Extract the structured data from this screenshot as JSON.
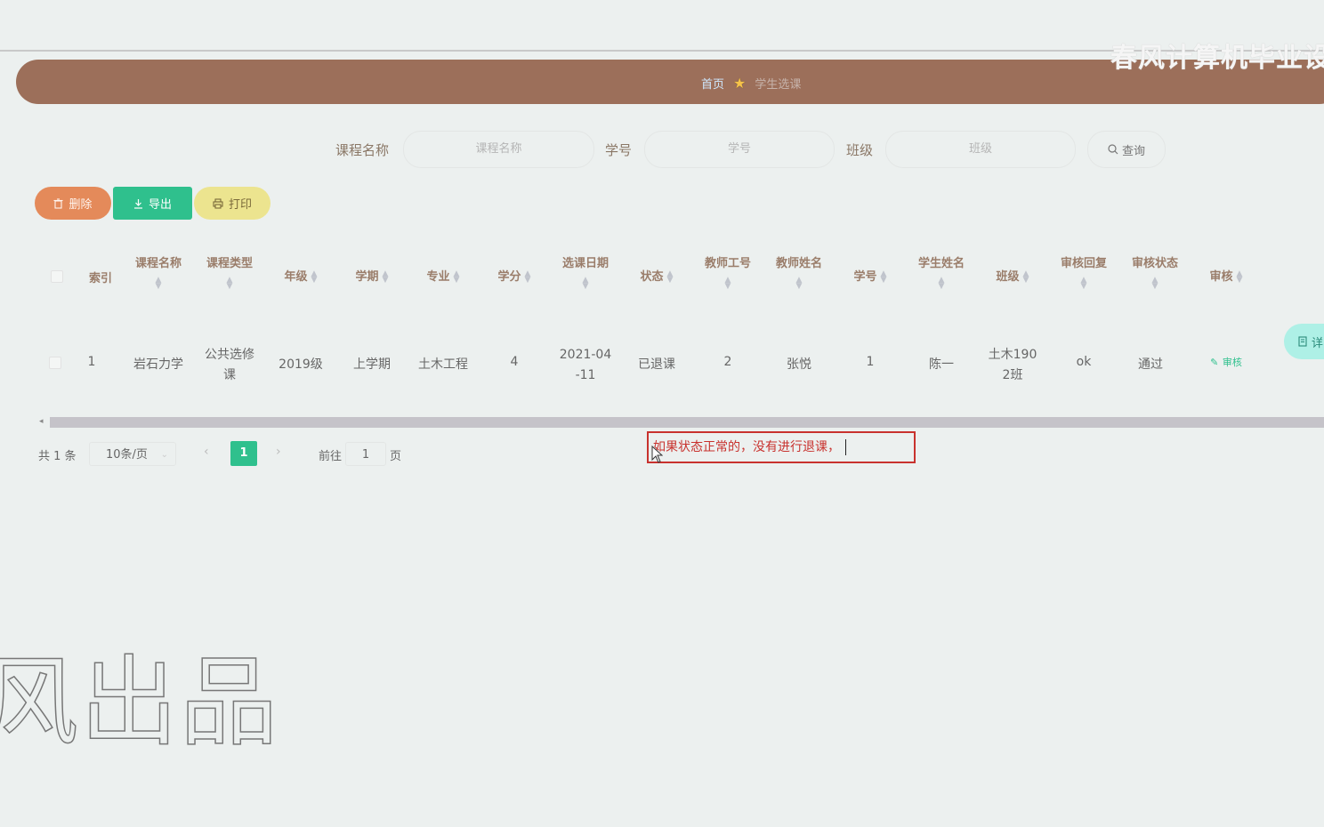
{
  "watermark": {
    "top": "春风计算机毕业设",
    "bottom": "风出品"
  },
  "breadcrumb": {
    "home": "首页",
    "current": "学生选课"
  },
  "search": {
    "course_label": "课程名称",
    "course_placeholder": "课程名称",
    "stuno_label": "学号",
    "stuno_placeholder": "学号",
    "class_label": "班级",
    "class_placeholder": "班级",
    "query_label": "查询"
  },
  "actions": {
    "delete_label": "删除",
    "export_label": "导出",
    "print_label": "打印"
  },
  "table": {
    "headers": {
      "index": "索引",
      "course": "课程名称",
      "ctype": "课程类型",
      "grade": "年级",
      "term": "学期",
      "major": "专业",
      "credit": "学分",
      "date": "选课日期",
      "status": "状态",
      "tno": "教师工号",
      "tname": "教师姓名",
      "sno": "学号",
      "sname": "学生姓名",
      "class": "班级",
      "reply": "审核回复",
      "astatus": "审核状态",
      "audit": "审核"
    },
    "rows": [
      {
        "index": "1",
        "course": "岩石力学",
        "ctype_1": "公共选修",
        "ctype_2": "课",
        "grade": "2019级",
        "term": "上学期",
        "major": "土木工程",
        "credit": "4",
        "date_1": "2021-04",
        "date_2": "-11",
        "status": "已退课",
        "tno": "2",
        "tname": "张悦",
        "sno": "1",
        "sname": "陈一",
        "class_1": "土木190",
        "class_2": "2班",
        "reply": "ok",
        "astatus": "通过",
        "audit": "审核",
        "detail": "详"
      }
    ]
  },
  "pagination": {
    "total": "共 1 条",
    "page_size": "10条/页",
    "current_page": "1",
    "goto_label": "前往",
    "goto_value": "1",
    "page_suffix": "页"
  },
  "note": "如果状态正常的，没有进行退课，",
  "colors": {
    "accent": "#2fc08d",
    "header_bar": "#9c6f5a",
    "delete": "#e48a5a",
    "print": "#ece48f",
    "note": "#c8322e"
  }
}
